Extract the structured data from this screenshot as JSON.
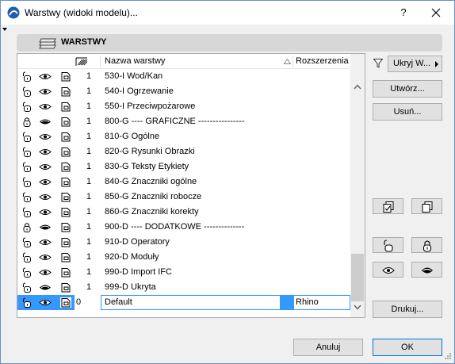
{
  "window": {
    "title": "Warstwy (widoki modelu)...",
    "help": "?"
  },
  "panel": {
    "header": "WARSTWY"
  },
  "table": {
    "col_name": "Nazwa warstwy",
    "col_ext": "Rozszerzenia",
    "rows": [
      {
        "lock": "unlocked",
        "view": "visible",
        "wire": "solid",
        "num": "1",
        "name": "530-I Wod/Kan",
        "ext": ""
      },
      {
        "lock": "unlocked",
        "view": "visible",
        "wire": "solid",
        "num": "1",
        "name": "540-I Ogrzewanie",
        "ext": ""
      },
      {
        "lock": "unlocked",
        "view": "visible",
        "wire": "solid",
        "num": "1",
        "name": "550-I Przeciwpożarowe",
        "ext": ""
      },
      {
        "lock": "locked",
        "view": "hidden",
        "wire": "solid",
        "num": "1",
        "name": "800-G ---- GRAFICZNE ----------------",
        "ext": ""
      },
      {
        "lock": "unlocked",
        "view": "visible",
        "wire": "solid",
        "num": "1",
        "name": "810-G Ogólne",
        "ext": ""
      },
      {
        "lock": "unlocked",
        "view": "visible",
        "wire": "solid",
        "num": "1",
        "name": "820-G Rysunki Obrazki",
        "ext": ""
      },
      {
        "lock": "unlocked",
        "view": "visible",
        "wire": "solid",
        "num": "1",
        "name": "830-G Teksty Etykiety",
        "ext": ""
      },
      {
        "lock": "unlocked",
        "view": "visible",
        "wire": "solid",
        "num": "1",
        "name": "840-G Znaczniki ogólne",
        "ext": ""
      },
      {
        "lock": "unlocked",
        "view": "visible",
        "wire": "solid",
        "num": "1",
        "name": "850-G Znaczniki robocze",
        "ext": ""
      },
      {
        "lock": "unlocked",
        "view": "visible",
        "wire": "solid",
        "num": "1",
        "name": "860-G Znaczniki korekty",
        "ext": ""
      },
      {
        "lock": "locked",
        "view": "hidden",
        "wire": "solid",
        "num": "1",
        "name": "900-D ---- DODATKOWE --------------",
        "ext": ""
      },
      {
        "lock": "unlocked",
        "view": "visible",
        "wire": "solid",
        "num": "1",
        "name": "910-D Operatory",
        "ext": ""
      },
      {
        "lock": "unlocked",
        "view": "visible",
        "wire": "solid",
        "num": "1",
        "name": "920-D Moduły",
        "ext": ""
      },
      {
        "lock": "unlocked",
        "view": "visible",
        "wire": "solid",
        "num": "1",
        "name": "990-D Import IFC",
        "ext": ""
      },
      {
        "lock": "unlocked",
        "view": "hidden",
        "wire": "solid",
        "num": "1",
        "name": "999-D Ukryta",
        "ext": ""
      }
    ],
    "selected_row": {
      "lock": "unlocked",
      "view": "visible",
      "wire": "solid",
      "num": "0",
      "name": "Default",
      "ext": "Rhino"
    }
  },
  "side": {
    "filter_dropdown": "Ukryj W...",
    "create": "Utwórz...",
    "delete": "Usuń...",
    "print": "Drukuj..."
  },
  "footer": {
    "cancel": "Anuluj",
    "ok": "OK"
  },
  "colors": {
    "selection": "#3399ff",
    "accent": "#0078d7"
  }
}
